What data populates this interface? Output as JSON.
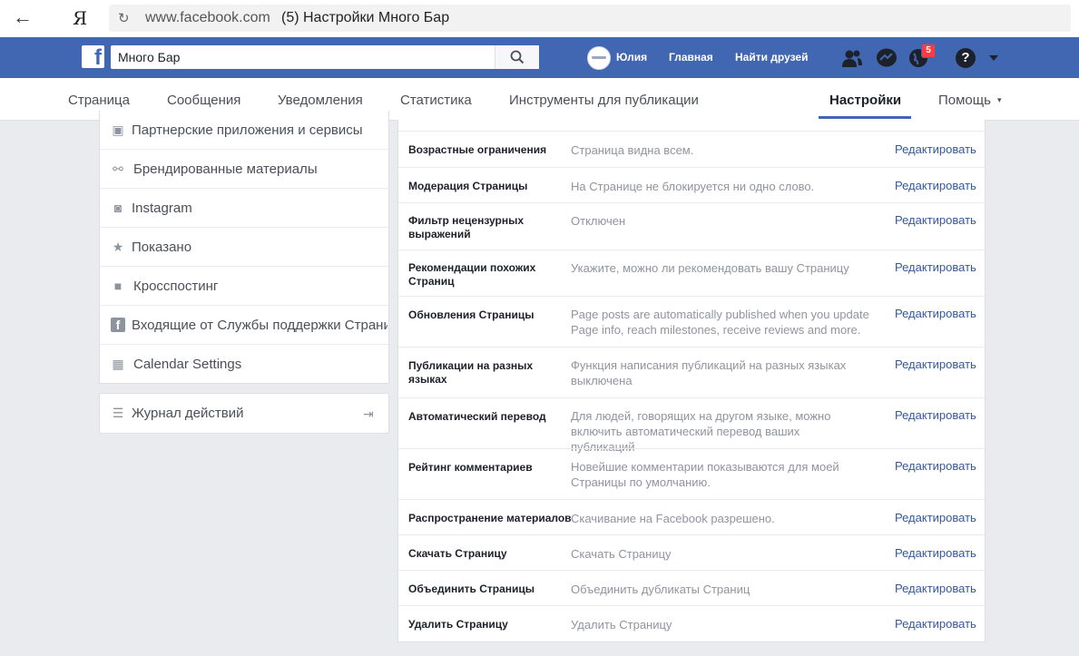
{
  "browser": {
    "back_label": "←",
    "ya_label": "Я",
    "reload_label": "↻",
    "url": "www.facebook.com",
    "title": "(5) Настройки Много Бар"
  },
  "fb": {
    "logo_letter": "f",
    "search_value": "Много Бар",
    "user_name": "Юлия",
    "home": "Главная",
    "find_friends": "Найти друзей",
    "notifications_count": "5",
    "help_label": "?"
  },
  "tabs": {
    "page": "Страница",
    "messages": "Сообщения",
    "notifications": "Уведомления",
    "stats": "Статистика",
    "tools": "Инструменты для публикации",
    "settings": "Настройки",
    "help": "Помощь",
    "help_caret": "▾"
  },
  "sidebar": {
    "items": [
      {
        "label": "Партнерские приложения и сервисы",
        "icon": "cube-icon",
        "glyph": "▣"
      },
      {
        "label": "Брендированные материалы",
        "icon": "handshake-icon",
        "glyph": "⚯"
      },
      {
        "label": "Instagram",
        "icon": "instagram-icon",
        "glyph": "◙"
      },
      {
        "label": "Показано",
        "icon": "star-icon",
        "glyph": "★"
      },
      {
        "label": "Кросспостинг",
        "icon": "video-camera-icon",
        "glyph": "■"
      },
      {
        "label": "Входящие от Службы поддержки Страниц",
        "icon": "facebook-square-icon",
        "glyph": "f"
      },
      {
        "label": "Calendar Settings",
        "icon": "calendar-icon",
        "glyph": "▦"
      }
    ],
    "journal": {
      "label": "Журнал действий",
      "icon": "list-icon",
      "glyph": "☰",
      "exit_glyph": "⇥"
    }
  },
  "settings_rows": [
    {
      "title": "Возрастные ограничения",
      "value": "Страница видна всем.",
      "edit": "Редактировать"
    },
    {
      "title": "Модерация Страницы",
      "value": "На Странице не блокируется ни одно слово.",
      "edit": "Редактировать"
    },
    {
      "title": "Фильтр нецензурных выражений",
      "value": "Отключен",
      "edit": "Редактировать"
    },
    {
      "title": "Рекомендации похожих Страниц",
      "value": "Укажите, можно ли рекомендовать вашу Страницу",
      "edit": "Редактировать"
    },
    {
      "title": "Обновления Страницы",
      "value": "Page posts are automatically published when you update Page info, reach milestones, receive reviews and more.",
      "edit": "Редактировать"
    },
    {
      "title": "Публикации на разных языках",
      "value": "Функция написания публикаций на разных языках выключена",
      "edit": "Редактировать"
    },
    {
      "title": "Автоматический перевод",
      "value": "Для людей, говорящих на другом языке, можно включить автоматический перевод ваших публикаций",
      "edit": "Редактировать"
    },
    {
      "title": "Рейтинг комментариев",
      "value": "Новейшие комментарии показываются для моей Страницы по умолчанию.",
      "edit": "Редактировать"
    },
    {
      "title": "Распространение материалов",
      "value": "Скачивание на Facebook разрешено.",
      "edit": "Редактировать"
    },
    {
      "title": "Скачать Страницу",
      "value": "Скачать Страницу",
      "edit": "Редактировать"
    },
    {
      "title": "Объединить Страницы",
      "value": "Объединить дубликаты Страниц",
      "edit": "Редактировать"
    },
    {
      "title": "Удалить Страницу",
      "value": "Удалить Страницу",
      "edit": "Редактировать"
    }
  ]
}
